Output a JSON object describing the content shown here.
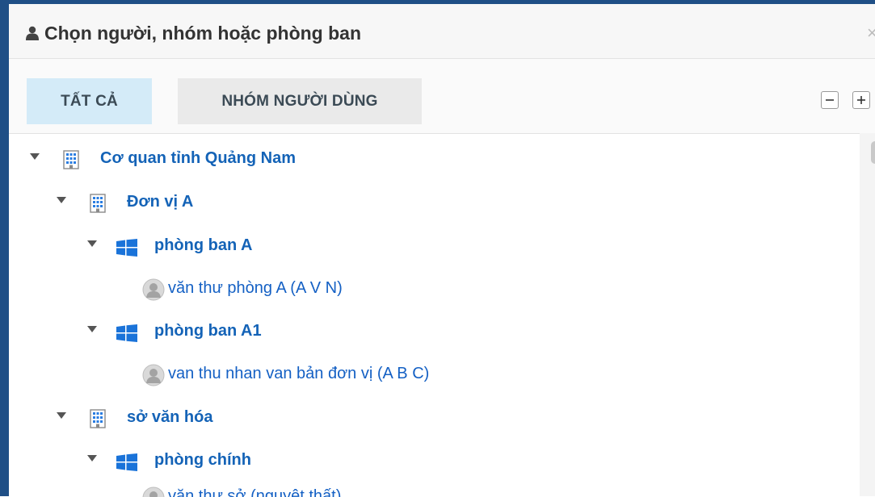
{
  "dialog": {
    "title": "Chọn người, nhóm hoặc phòng ban",
    "close_glyph": "×"
  },
  "tabs": [
    {
      "label": "TẤT CẢ",
      "active": true
    },
    {
      "label": "NHÓM NGƯỜI DÙNG",
      "active": false
    }
  ],
  "tree": {
    "nodes": [
      {
        "type": "org",
        "label": "Cơ quan tỉnh Quảng Nam",
        "expanded": true,
        "icon": "building-icon"
      },
      {
        "type": "org",
        "label": "Đơn vị A",
        "expanded": true,
        "icon": "building-icon"
      },
      {
        "type": "dept",
        "label": "phòng ban A",
        "expanded": true,
        "icon": "windows-icon"
      },
      {
        "type": "user",
        "label": "văn thư phòng A (A V N)",
        "icon": "user-avatar-icon"
      },
      {
        "type": "dept",
        "label": "phòng ban A1",
        "expanded": true,
        "icon": "windows-icon"
      },
      {
        "type": "user",
        "label": "van thu nhan van bản đơn vị (A B C)",
        "icon": "user-avatar-icon"
      },
      {
        "type": "org",
        "label": "sở văn hóa",
        "expanded": true,
        "icon": "building-icon"
      },
      {
        "type": "dept",
        "label": "phòng chính",
        "expanded": true,
        "icon": "windows-icon"
      },
      {
        "type": "user",
        "label": "văn thư sở (nguyệt thất)",
        "icon": "user-avatar-icon"
      }
    ]
  },
  "colors": {
    "frame": "#1f4f86",
    "link": "#1463b7",
    "active_tab": "#d4ebf8",
    "inactive_tab": "#eaeaea",
    "dept_icon": "#1a73d9"
  }
}
